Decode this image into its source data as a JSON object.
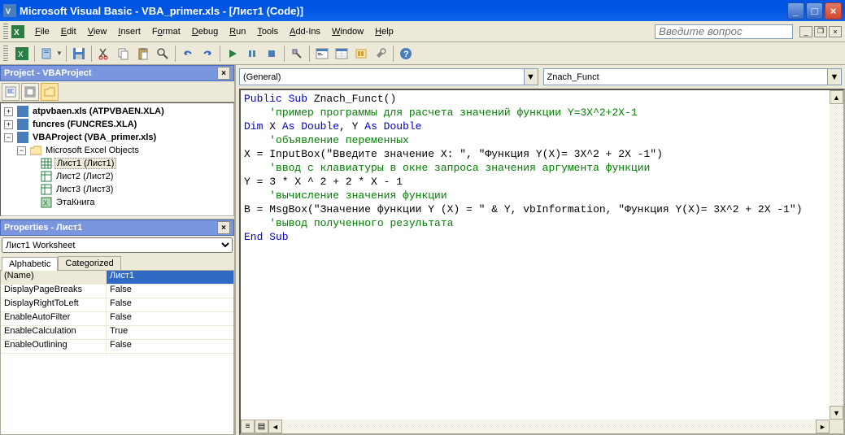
{
  "title": "Microsoft Visual Basic - VBA_primer.xls - [Лист1 (Code)]",
  "menu": {
    "file": "File",
    "edit": "Edit",
    "view": "View",
    "insert": "Insert",
    "format": "Format",
    "debug": "Debug",
    "run": "Run",
    "tools": "Tools",
    "addins": "Add-Ins",
    "window": "Window",
    "help": "Help"
  },
  "help_search_placeholder": "Введите вопрос",
  "project_panel_title": "Project - VBAProject",
  "tree": {
    "atpv": "atpvbaen.xls (ATPVBAEN.XLA)",
    "funcres": "funcres (FUNCRES.XLA)",
    "vbaproj": "VBAProject (VBA_primer.xls)",
    "meo": "Microsoft Excel Objects",
    "sheet1": "Лист1 (Лист1)",
    "sheet2": "Лист2 (Лист2)",
    "sheet3": "Лист3 (Лист3)",
    "workbook": "ЭтаКнига"
  },
  "props_panel_title": "Properties - Лист1",
  "props_object": "Лист1 Worksheet",
  "props_tabs": {
    "alpha": "Alphabetic",
    "cat": "Categorized"
  },
  "props": [
    {
      "name": "(Name)",
      "val": "Лист1",
      "sel": true
    },
    {
      "name": "DisplayPageBreaks",
      "val": "False"
    },
    {
      "name": "DisplayRightToLeft",
      "val": "False"
    },
    {
      "name": "EnableAutoFilter",
      "val": "False"
    },
    {
      "name": "EnableCalculation",
      "val": "True"
    },
    {
      "name": "EnableOutlining",
      "val": "False"
    }
  ],
  "code_combo_left": "(General)",
  "code_combo_right": "Znach_Funct",
  "code": [
    {
      "t": "kw",
      "s": "Public Sub "
    },
    {
      "t": "",
      "s": "Znach_Funct()"
    },
    {
      "t": "nl"
    },
    {
      "t": "pad",
      "s": "    "
    },
    {
      "t": "cm",
      "s": "'пример программы для расчета значений функции Y=3X^2+2X-1"
    },
    {
      "t": "nl"
    },
    {
      "t": "nl"
    },
    {
      "t": "kw",
      "s": "Dim "
    },
    {
      "t": "",
      "s": "X "
    },
    {
      "t": "kw",
      "s": "As Double"
    },
    {
      "t": "",
      "s": ", Y "
    },
    {
      "t": "kw",
      "s": "As Double"
    },
    {
      "t": "nl"
    },
    {
      "t": "pad",
      "s": "    "
    },
    {
      "t": "cm",
      "s": "'объявление переменных"
    },
    {
      "t": "nl"
    },
    {
      "t": "nl"
    },
    {
      "t": "",
      "s": "X = InputBox(\"Введите значение X: \", \"Функция Y(X)= 3X^2 + 2X -1\")"
    },
    {
      "t": "nl"
    },
    {
      "t": "pad",
      "s": "    "
    },
    {
      "t": "cm",
      "s": "'ввод с клавиатуры в окне запроса значения аргумента функции"
    },
    {
      "t": "nl"
    },
    {
      "t": "nl"
    },
    {
      "t": "",
      "s": "Y = 3 * X ^ 2 + 2 * X - 1"
    },
    {
      "t": "nl"
    },
    {
      "t": "pad",
      "s": "    "
    },
    {
      "t": "cm",
      "s": "'вычисление значения функции"
    },
    {
      "t": "nl"
    },
    {
      "t": "nl"
    },
    {
      "t": "",
      "s": "B = MsgBox(\"Значение функции Y (X) = \" & Y, vbInformation, \"Функция Y(X)= 3X^2 + 2X -1\")"
    },
    {
      "t": "nl"
    },
    {
      "t": "pad",
      "s": "    "
    },
    {
      "t": "cm",
      "s": "'вывод полученного результата"
    },
    {
      "t": "nl"
    },
    {
      "t": "nl"
    },
    {
      "t": "kw",
      "s": "End Sub"
    },
    {
      "t": "nl"
    }
  ]
}
